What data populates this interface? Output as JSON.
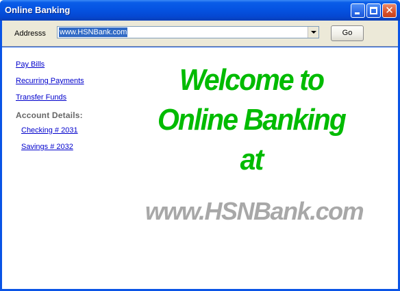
{
  "window": {
    "title": "Online Banking"
  },
  "address_bar": {
    "label": "Addresss",
    "value": "www.HSNBank.com",
    "go_label": "Go"
  },
  "nav": {
    "links": [
      {
        "label": "Pay Bills"
      },
      {
        "label": "Recurring Payments"
      },
      {
        "label": "Transfer Funds"
      }
    ],
    "account_details_label": "Account Details:",
    "accounts": [
      {
        "label": "Checking # 2031"
      },
      {
        "label": "Savings # 2032"
      }
    ]
  },
  "main": {
    "welcome_lines": [
      "Welcome to",
      "Online Banking",
      "at"
    ],
    "site_name": "www.HSNBank.com"
  },
  "colors": {
    "title_bar": "#0553e2",
    "welcome_text": "#00bb00",
    "site_text": "#a8a8a8",
    "link": "#0000cc"
  },
  "icons": [
    "minimize-icon",
    "maximize-icon",
    "close-icon",
    "dropdown-arrow-icon"
  ]
}
